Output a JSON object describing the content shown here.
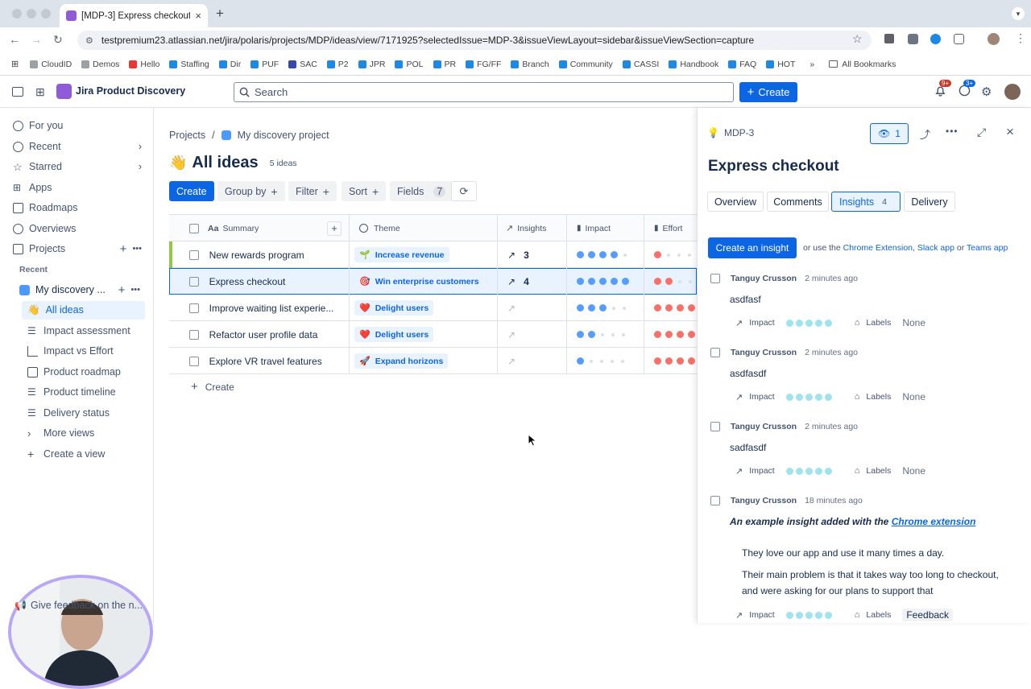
{
  "browser": {
    "tab_title": "[MDP-3] Express checkout -",
    "url": "testpremium23.atlassian.net/jira/polaris/projects/MDP/ideas/view/7171925?selectedIssue=MDP-3&issueViewLayout=sidebar&issueViewSection=capture",
    "bookmarks": [
      "CloudID",
      "Demos",
      "Hello",
      "Staffing",
      "Dir",
      "PUF",
      "SAC",
      "P2",
      "JPR",
      "POL",
      "PR",
      "FG/FF",
      "Branch",
      "Community",
      "CASSI",
      "Handbook",
      "FAQ",
      "HOT"
    ],
    "all_bookmarks": "All Bookmarks",
    "bookmark_colors": [
      "#9aa0a6",
      "#9aa0a6",
      "#e53935",
      "#1e88e5",
      "#1e88e5",
      "#1e88e5",
      "#3949ab",
      "#1e88e5",
      "#1e88e5",
      "#1e88e5",
      "#1e88e5",
      "#1e88e5",
      "#1e88e5",
      "#1e88e5",
      "#1e88e5",
      "#1e88e5",
      "#1e88e5",
      "#1e88e5"
    ]
  },
  "header": {
    "product_name": "Jira Product Discovery",
    "search_placeholder": "Search",
    "create_label": "Create",
    "notif_badge": "9+",
    "help_badge": "3+"
  },
  "sidebar": {
    "for_you": "For you",
    "recent": "Recent",
    "starred": "Starred",
    "apps": "Apps",
    "roadmaps": "Roadmaps",
    "overviews": "Overviews",
    "projects": "Projects",
    "recent_section": "Recent",
    "project_name": "My discovery ...",
    "views": [
      "All ideas",
      "Impact assessment",
      "Impact vs Effort",
      "Product roadmap",
      "Product timeline",
      "Delivery status"
    ],
    "more_views": "More views",
    "create_view": "Create a view",
    "feedback": "Give feedback on the n..."
  },
  "main": {
    "breadcrumb_root": "Projects",
    "breadcrumb_project": "My discovery project",
    "title": "All ideas",
    "title_emoji": "👋",
    "count": "5 ideas",
    "create": "Create",
    "group_by": "Group by",
    "filter": "Filter",
    "sort": "Sort",
    "fields": "Fields",
    "fields_count": "7",
    "columns": [
      "Summary",
      "Theme",
      "Insights",
      "Impact",
      "Effort"
    ],
    "column_prefix": "Aa",
    "rows": [
      {
        "summary": "New rewards program",
        "theme": "Increase revenue",
        "theme_emoji": "🌱",
        "insights": "3",
        "impact": 4,
        "effort": 1
      },
      {
        "summary": "Express checkout",
        "theme": "Win enterprise customers",
        "theme_emoji": "🎯",
        "insights": "4",
        "impact": 5,
        "effort": 2
      },
      {
        "summary": "Improve waiting list experie...",
        "theme": "Delight users",
        "theme_emoji": "❤️",
        "insights": "",
        "impact": 3,
        "effort": 4
      },
      {
        "summary": "Refactor user profile data",
        "theme": "Delight users",
        "theme_emoji": "❤️",
        "insights": "",
        "impact": 2,
        "effort": 4
      },
      {
        "summary": "Explore VR travel features",
        "theme": "Expand horizons",
        "theme_emoji": "🚀",
        "insights": "",
        "impact": 1,
        "effort": 4
      }
    ],
    "create_row": "Create",
    "colors": {
      "impact": "#579dff",
      "effort": "#f87168",
      "empty": "#dcdfe4"
    }
  },
  "panel": {
    "issue_key": "MDP-3",
    "watchers": "1",
    "title": "Express checkout",
    "tabs": [
      "Overview",
      "Comments",
      "Insights",
      "Delivery"
    ],
    "insights_count": "4",
    "create_insight": "Create an insight",
    "use_text": "or use the",
    "link_chrome": "Chrome Extension",
    "link_slack": "Slack app",
    "or_text": "or",
    "link_teams": "Teams app",
    "insights": [
      {
        "author": "Tanguy Crusson",
        "time": "2 minutes ago",
        "text": "asdfasf",
        "labels": "None"
      },
      {
        "author": "Tanguy Crusson",
        "time": "2 minutes ago",
        "text": "asdfasdf",
        "labels": "None"
      },
      {
        "author": "Tanguy Crusson",
        "time": "2 minutes ago",
        "text": "sadfasdf",
        "labels": "None"
      },
      {
        "author": "Tanguy Crusson",
        "time": "18 minutes ago",
        "text_prefix": "An example insight added with the",
        "text_link": "Chrome extension",
        "quote1": "They love our app and use it many times a day.",
        "quote2": "Their main problem is that it takes way too long to checkout, and were asking for our plans to support that",
        "labels": "Feedback"
      }
    ],
    "impact_label": "Impact",
    "labels_label": "Labels"
  }
}
